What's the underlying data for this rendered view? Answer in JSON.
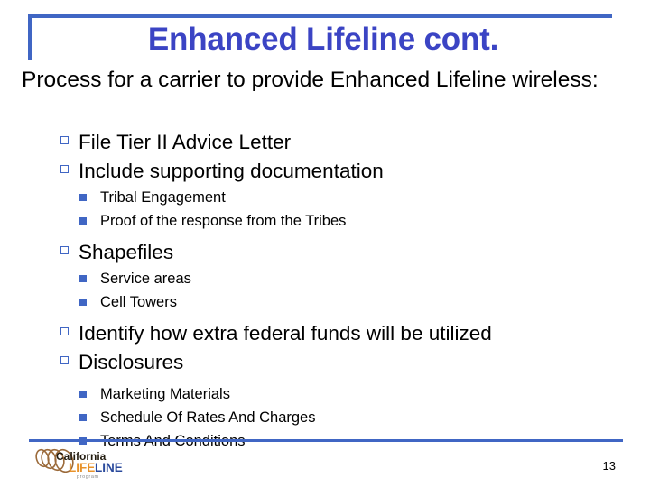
{
  "slide": {
    "title": "Enhanced Lifeline cont.",
    "intro": "Process for a carrier to provide Enhanced Lifeline wireless:",
    "title_color": "#3b44c4",
    "accent_color": "#4066c4",
    "bullets": [
      {
        "level": 1,
        "text": "File Tier II Advice Letter"
      },
      {
        "level": 1,
        "text": "Include supporting documentation"
      },
      {
        "level": 2,
        "text": "Tribal Engagement"
      },
      {
        "level": 2,
        "text": "Proof of the response from the Tribes"
      },
      {
        "level": 1,
        "text": "Shapefiles"
      },
      {
        "level": 2,
        "text": "Service areas"
      },
      {
        "level": 2,
        "text": "Cell Towers"
      },
      {
        "level": 1,
        "text": "Identify how extra federal funds will be utilized"
      },
      {
        "level": 1,
        "text": "Disclosures"
      },
      {
        "level": 2,
        "text": "Marketing Materials"
      },
      {
        "level": 2,
        "text": "Schedule Of Rates And Charges"
      },
      {
        "level": 2,
        "text": "Terms And Conditions"
      }
    ]
  },
  "footer": {
    "page_number": "13",
    "logo": {
      "line1": "California",
      "line2a": "LIFE",
      "line2b": "LINE",
      "line3": "program",
      "arc_color": "#9b6a3a",
      "life_color": "#e8922a",
      "line_color": "#2a4a9c",
      "california_color": "#221b0f"
    }
  }
}
